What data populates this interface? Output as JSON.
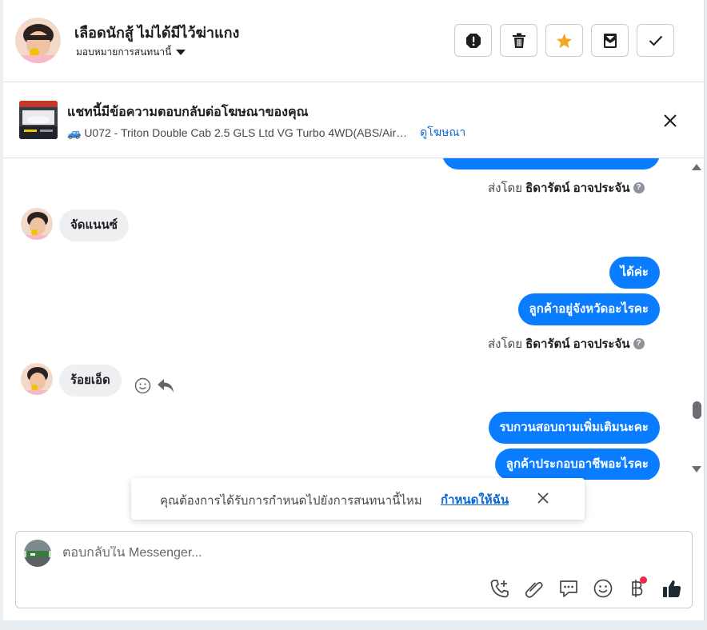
{
  "header": {
    "contact_name": "เลือดนักสู้ ไม่ได้มีไว้ฆ่าแกง",
    "assign_label": "มอบหมายการสนทนานี้",
    "actions": [
      "alert-icon",
      "trash-icon",
      "star-icon",
      "archive-icon",
      "check-icon"
    ],
    "star_color": "#f5a623"
  },
  "ad": {
    "title": "แชทนี้มีข้อความตอบกลับต่อโฆษณาของคุณ",
    "listing": "🚙 U072 - Triton Double Cab 2.5 GLS Ltd VG Turbo 4WD(ABS/Air…",
    "view_link": "ดูโฆษณา"
  },
  "messages": {
    "sent_by_prefix": "ส่งโดย",
    "agent_name": "ธิดารัตน์ อาจประจัน",
    "items": [
      {
        "dir": "out",
        "text": ""
      },
      {
        "dir": "in",
        "text": "จัดแนนซ์"
      },
      {
        "dir": "out",
        "text": "ได้ค่ะ"
      },
      {
        "dir": "out",
        "text": "ลูกค้าอยู่จังหวัดอะไรคะ"
      },
      {
        "dir": "in",
        "text": "ร้อยเอ็ด"
      },
      {
        "dir": "out",
        "text": "รบกวนสอบถามเพิ่มเติมนะคะ"
      },
      {
        "dir": "out",
        "text": "ลูกค้าประกอบอาชีพอะไรคะ"
      }
    ],
    "bubble_color": "#0a7cff"
  },
  "toast": {
    "text": "คุณต้องการได้รับการกำหนดไปยังการสนทนานี้ไหม",
    "link": "กำหนดให้ฉัน"
  },
  "composer": {
    "placeholder": "ตอบกลับใน Messenger...",
    "tools": [
      "call-add-icon",
      "paperclip-icon",
      "saved-reply-icon",
      "emoji-icon",
      "baht-payment-icon",
      "thumbs-up-icon"
    ]
  }
}
